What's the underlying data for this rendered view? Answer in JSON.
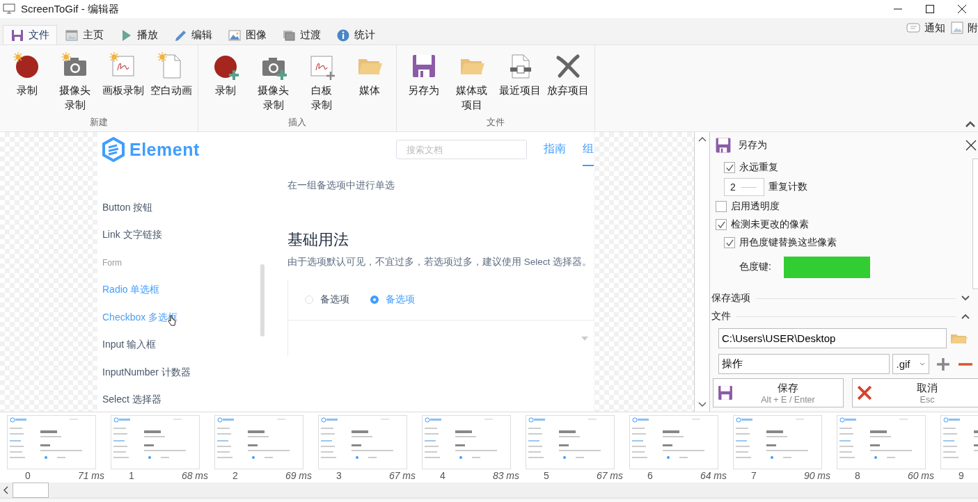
{
  "window": {
    "title": "ScreenToGif - 编辑器"
  },
  "tabs": [
    {
      "label": "文件",
      "selected": true
    },
    {
      "label": "主页",
      "selected": false
    },
    {
      "label": "播放",
      "selected": false
    },
    {
      "label": "编辑",
      "selected": false
    },
    {
      "label": "图像",
      "selected": false
    },
    {
      "label": "过渡",
      "selected": false
    },
    {
      "label": "统计",
      "selected": false
    }
  ],
  "extras": [
    {
      "label": "通知"
    },
    {
      "label": "附"
    }
  ],
  "ribbon": [
    {
      "label": "新建",
      "buttons": [
        [
          "录制"
        ],
        [
          "摄像头",
          "录制"
        ],
        [
          "画板录制"
        ],
        [
          "空白动画"
        ]
      ]
    },
    {
      "label": "插入",
      "buttons": [
        [
          "录制"
        ],
        [
          "摄像头",
          "录制"
        ],
        [
          "白板",
          "录制"
        ],
        [
          "媒体"
        ]
      ]
    },
    {
      "label": "文件",
      "buttons": [
        [
          "另存为"
        ],
        [
          "媒体或",
          "项目"
        ],
        [
          "最近项目"
        ],
        [
          "放弃项目"
        ]
      ]
    }
  ],
  "frame": {
    "logo": "Element",
    "search": {
      "placeholder": "搜索文档"
    },
    "nav": [
      {
        "label": "指南",
        "selected": false
      },
      {
        "label": "组",
        "selected": true
      }
    ],
    "sidebar": [
      {
        "kind": "link",
        "label": "Button 按钮",
        "selected": false,
        "hovered": false
      },
      {
        "kind": "link",
        "label": "Link 文字链接",
        "selected": false,
        "hovered": false
      },
      {
        "kind": "heading",
        "label": "Form"
      },
      {
        "kind": "link",
        "label": "Radio 单选框",
        "selected": true,
        "hovered": false
      },
      {
        "kind": "link",
        "label": "Checkbox 多选框",
        "selected": false,
        "hovered": true
      },
      {
        "kind": "link",
        "label": "Input 输入框",
        "selected": false,
        "hovered": false
      },
      {
        "kind": "link",
        "label": "InputNumber 计数器",
        "selected": false,
        "hovered": false
      },
      {
        "kind": "link",
        "label": "Select 选择器",
        "selected": false,
        "hovered": false
      }
    ],
    "intro": "在一组备选项中进行单选",
    "heading": "基础用法",
    "description": "由于选项默认可见，不宜过多，若选项过多，建议使用 Select 选择器。",
    "radios": [
      {
        "label": "备选项",
        "selected": false
      },
      {
        "label": "备选项",
        "selected": true
      }
    ]
  },
  "panel": {
    "title": "另存为",
    "loop": [
      {
        "kind": "checkbox",
        "label": "永远重复",
        "checked": true
      },
      {
        "kind": "number",
        "number": "2",
        "label": "重复计数"
      }
    ],
    "options": [
      {
        "kind": "checkbox",
        "label": "启用透明度",
        "checked": false
      },
      {
        "kind": "checkbox",
        "label": "检测未更改的像素",
        "checked": true,
        "children": [
          {
            "kind": "checkbox",
            "label": "用色度键替换这些像素",
            "checked": true,
            "children": [
              {
                "kind": "color",
                "label": "色度键:",
                "color": "#32cd32"
              }
            ]
          }
        ]
      }
    ],
    "sections": [
      {
        "label": "保存选项",
        "expanded": false
      },
      {
        "label": "文件",
        "expanded": true
      }
    ],
    "file": {
      "folder": "C:\\Users\\USER\\Desktop",
      "filename": "操作",
      "extension": ".gif"
    },
    "buttons": [
      {
        "kind": "save",
        "label": "保存",
        "shortcut": "Alt + E / Enter"
      },
      {
        "kind": "cancel",
        "label": "取消",
        "shortcut": "Esc"
      }
    ]
  },
  "timeline": [
    {
      "index": "0",
      "delay": "71 ms"
    },
    {
      "index": "1",
      "delay": "68 ms"
    },
    {
      "index": "2",
      "delay": "69 ms"
    },
    {
      "index": "3",
      "delay": "67 ms"
    },
    {
      "index": "4",
      "delay": "83 ms"
    },
    {
      "index": "5",
      "delay": "67 ms"
    },
    {
      "index": "6",
      "delay": "64 ms"
    },
    {
      "index": "7",
      "delay": "90 ms"
    },
    {
      "index": "8",
      "delay": "60 ms"
    },
    {
      "index": "9"
    }
  ]
}
